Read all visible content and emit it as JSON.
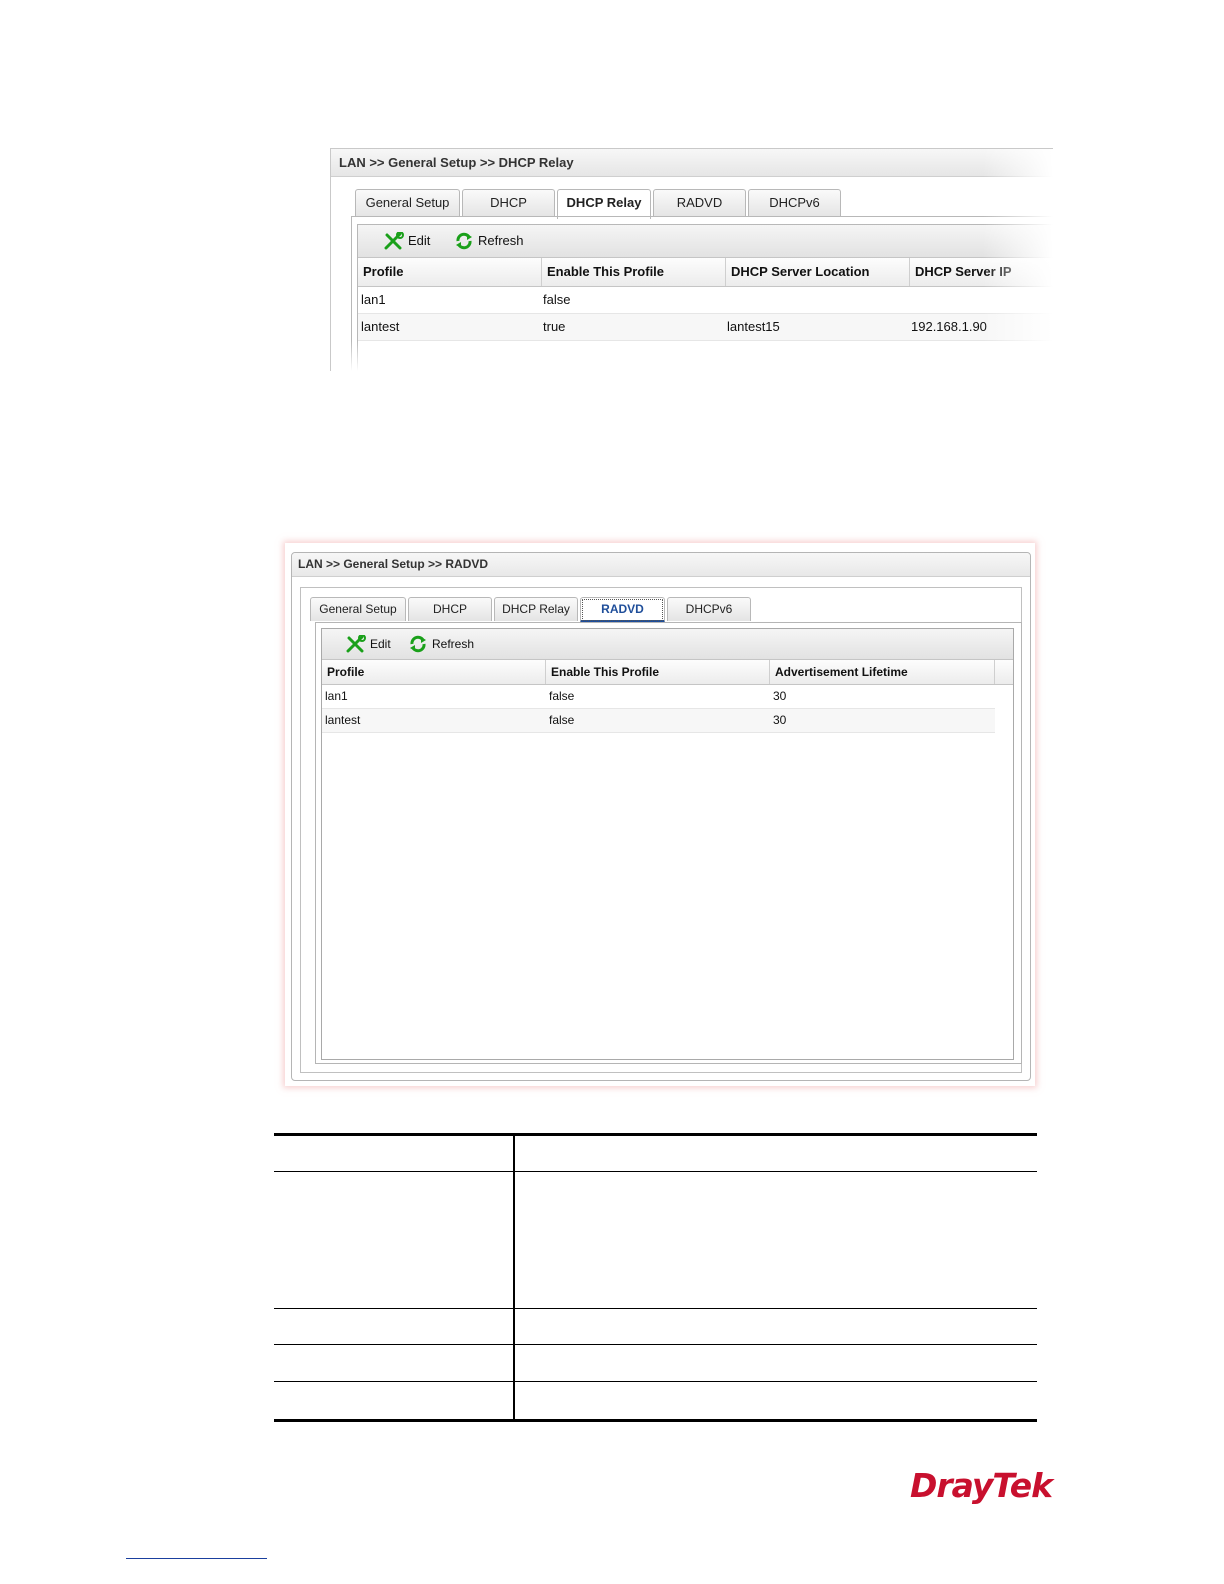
{
  "dhcp_relay_screen": {
    "breadcrumb": "LAN >> General Setup >> DHCP Relay",
    "tabs": [
      "General Setup",
      "DHCP",
      "DHCP Relay",
      "RADVD",
      "DHCPv6"
    ],
    "active_tab": "DHCP Relay",
    "toolbar": {
      "edit_label": "Edit",
      "refresh_label": "Refresh"
    },
    "columns": [
      "Profile",
      "Enable This Profile",
      "DHCP Server Location",
      "DHCP Server IP"
    ],
    "rows": [
      {
        "profile": "lan1",
        "enable": "false",
        "location": "",
        "ip": ""
      },
      {
        "profile": "lantest",
        "enable": "true",
        "location": "lantest15",
        "ip": "192.168.1.90"
      }
    ]
  },
  "radvd_screen": {
    "breadcrumb": "LAN >> General Setup >> RADVD",
    "tabs": [
      "General Setup",
      "DHCP",
      "DHCP Relay",
      "RADVD",
      "DHCPv6"
    ],
    "active_tab": "RADVD",
    "toolbar": {
      "edit_label": "Edit",
      "refresh_label": "Refresh"
    },
    "columns": [
      "Profile",
      "Enable This Profile",
      "Advertisement Lifetime"
    ],
    "rows": [
      {
        "profile": "lan1",
        "enable": "false",
        "lifetime": "30"
      },
      {
        "profile": "lantest",
        "enable": "false",
        "lifetime": "30"
      }
    ]
  },
  "logo": {
    "text": "DrayTek",
    "color": "#c8102e"
  },
  "colors": {
    "accent_icon": "#1aa01a",
    "active_tab_text": "#1f4e9a"
  }
}
